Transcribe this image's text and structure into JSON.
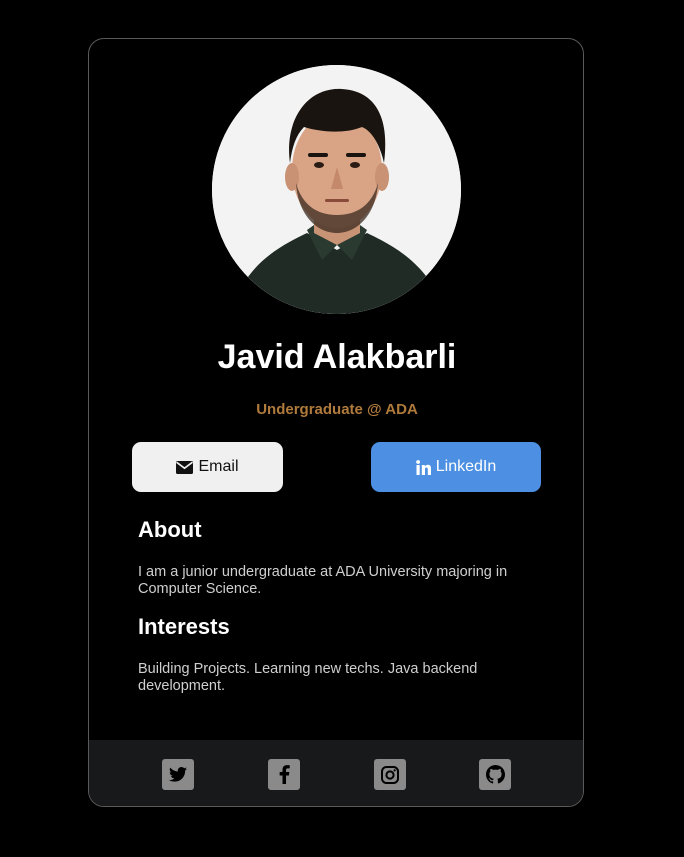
{
  "profile": {
    "name": "Javid Alakbarli",
    "subtitle": "Undergraduate @ ADA",
    "photo_alt": "Javid Alakbarli"
  },
  "buttons": {
    "email_label": "Email",
    "email_icon": "envelope-icon",
    "linkedin_label": "LinkedIn",
    "linkedin_icon": "linkedin-icon"
  },
  "about": {
    "title": "About",
    "text": "I am a junior undergraduate at ADA University majoring in Computer Science."
  },
  "interests": {
    "title": "Interests",
    "text": "Building Projects. Learning new techs. Java backend development."
  },
  "footer": {
    "socials": [
      {
        "name": "twitter-icon"
      },
      {
        "name": "facebook-icon"
      },
      {
        "name": "instagram-icon"
      },
      {
        "name": "github-icon"
      }
    ]
  },
  "colors": {
    "background": "#000000",
    "subtitle": "#b07a3c",
    "linkedin": "#4c8fe3",
    "email_button": "#f0f0f0",
    "footer": "#18191b",
    "social_icon_bg": "#8a8a8a"
  }
}
